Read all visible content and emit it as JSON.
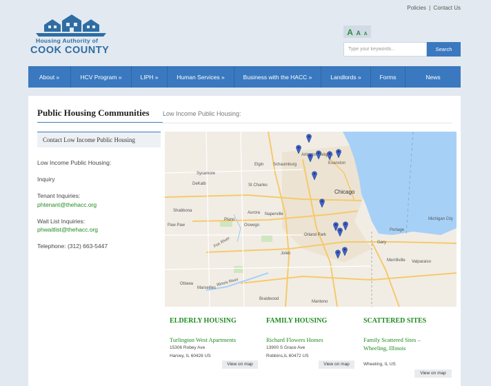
{
  "top_links": {
    "policies": "Policies",
    "separator": "|",
    "contact": "Contact Us"
  },
  "logo": {
    "line1": "Housing Authority of",
    "line2": "COOK COUNTY"
  },
  "font_sizer": {
    "large": "A",
    "medium": "A",
    "small": "A"
  },
  "search": {
    "placeholder": "Type your keywords...",
    "button": "Search"
  },
  "nav": [
    "About »",
    "HCV Program »",
    "LIPH »",
    "Human Services »",
    "Business with the HACC »",
    "Landlords »",
    "Forms",
    "News"
  ],
  "page": {
    "title": "Public Housing Communities",
    "subtitle": "Low Income Public Housing:"
  },
  "sidebar": {
    "contact_head": "Contact Low Income Public Housing",
    "intro": "Low Income Public Housing:",
    "inquiry": "Inquiry",
    "tenant_label": "Tenant Inquiries:",
    "tenant_email": "phtenant@thehacc.org",
    "waitlist_label": "Wait List Inquiries:",
    "waitlist_email": "phwaitlist@thehacc.org",
    "telephone": "Telephone: (312) 663-5447"
  },
  "map": {
    "labels": [
      "Arlington Heights",
      "Evanston",
      "Elgin",
      "Schaumburg",
      "Sycamore",
      "DeKalb",
      "St Charles",
      "Chicago",
      "Naperville",
      "Aurora",
      "Shabbona",
      "Plano",
      "Oswego",
      "Paw Paw",
      "Orland Park",
      "Joliet",
      "Gary",
      "Michigan City",
      "Merrillville",
      "Portage",
      "Valparaiso",
      "Ottawa",
      "Marseilles",
      "Braidwood",
      "Manteno",
      "Fox River",
      "Illinois River"
    ],
    "colors": {
      "land": "#f1ede5",
      "water": "#a7d0f7",
      "pin": "#3f63c7"
    }
  },
  "listings": [
    {
      "heading": "ELDERLY HOUSING",
      "name": "Turlington West Apartments",
      "address1": "15306 Robey Ave",
      "address2": "Harvey, IL 60426 US",
      "button": "View on map"
    },
    {
      "heading": "FAMILY HOUSING",
      "name": "Richard Flowers Homes",
      "address1": "13900 S Grace Ave",
      "address2": "Robbins,IL 60472 US",
      "button": "View on map"
    },
    {
      "heading": "SCATTERED SITES",
      "name": "Family Scattered Sites – Wheeling, Illinois",
      "address1": "",
      "address2": "Wheeling, IL US",
      "button": "View on map"
    }
  ]
}
